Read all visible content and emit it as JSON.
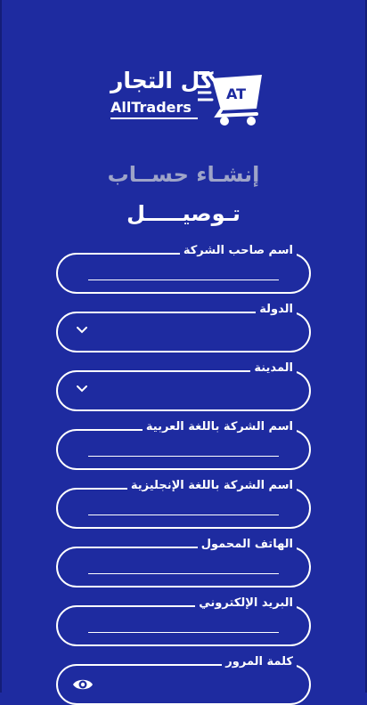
{
  "logo": {
    "arabic_text": "كل التجار",
    "english_text": "AllTraders",
    "cart_badge": "AT"
  },
  "page": {
    "subtitle": "إنشـاء حســاب",
    "title": "تـوصيـــــل"
  },
  "form": {
    "fields": [
      {
        "label": "اسم صاحب الشركة",
        "type": "text"
      },
      {
        "label": "الدولة",
        "type": "select"
      },
      {
        "label": "المدينة",
        "type": "select"
      },
      {
        "label": "اسم الشركة باللغة العربية",
        "type": "text"
      },
      {
        "label": "اسم الشركة باللغة الإنجليزية",
        "type": "text"
      },
      {
        "label": "الهاتف المحمول",
        "type": "text"
      },
      {
        "label": "البريد الإلكتروني",
        "type": "text"
      },
      {
        "label": "كلمة المرور",
        "type": "password"
      }
    ]
  },
  "icons": {
    "dropdown": "chevron-down-icon",
    "password_toggle": "eye-icon"
  },
  "colors": {
    "background": "#1e2ba0",
    "subtitle": "#9ea4c8",
    "foreground": "#ffffff"
  }
}
